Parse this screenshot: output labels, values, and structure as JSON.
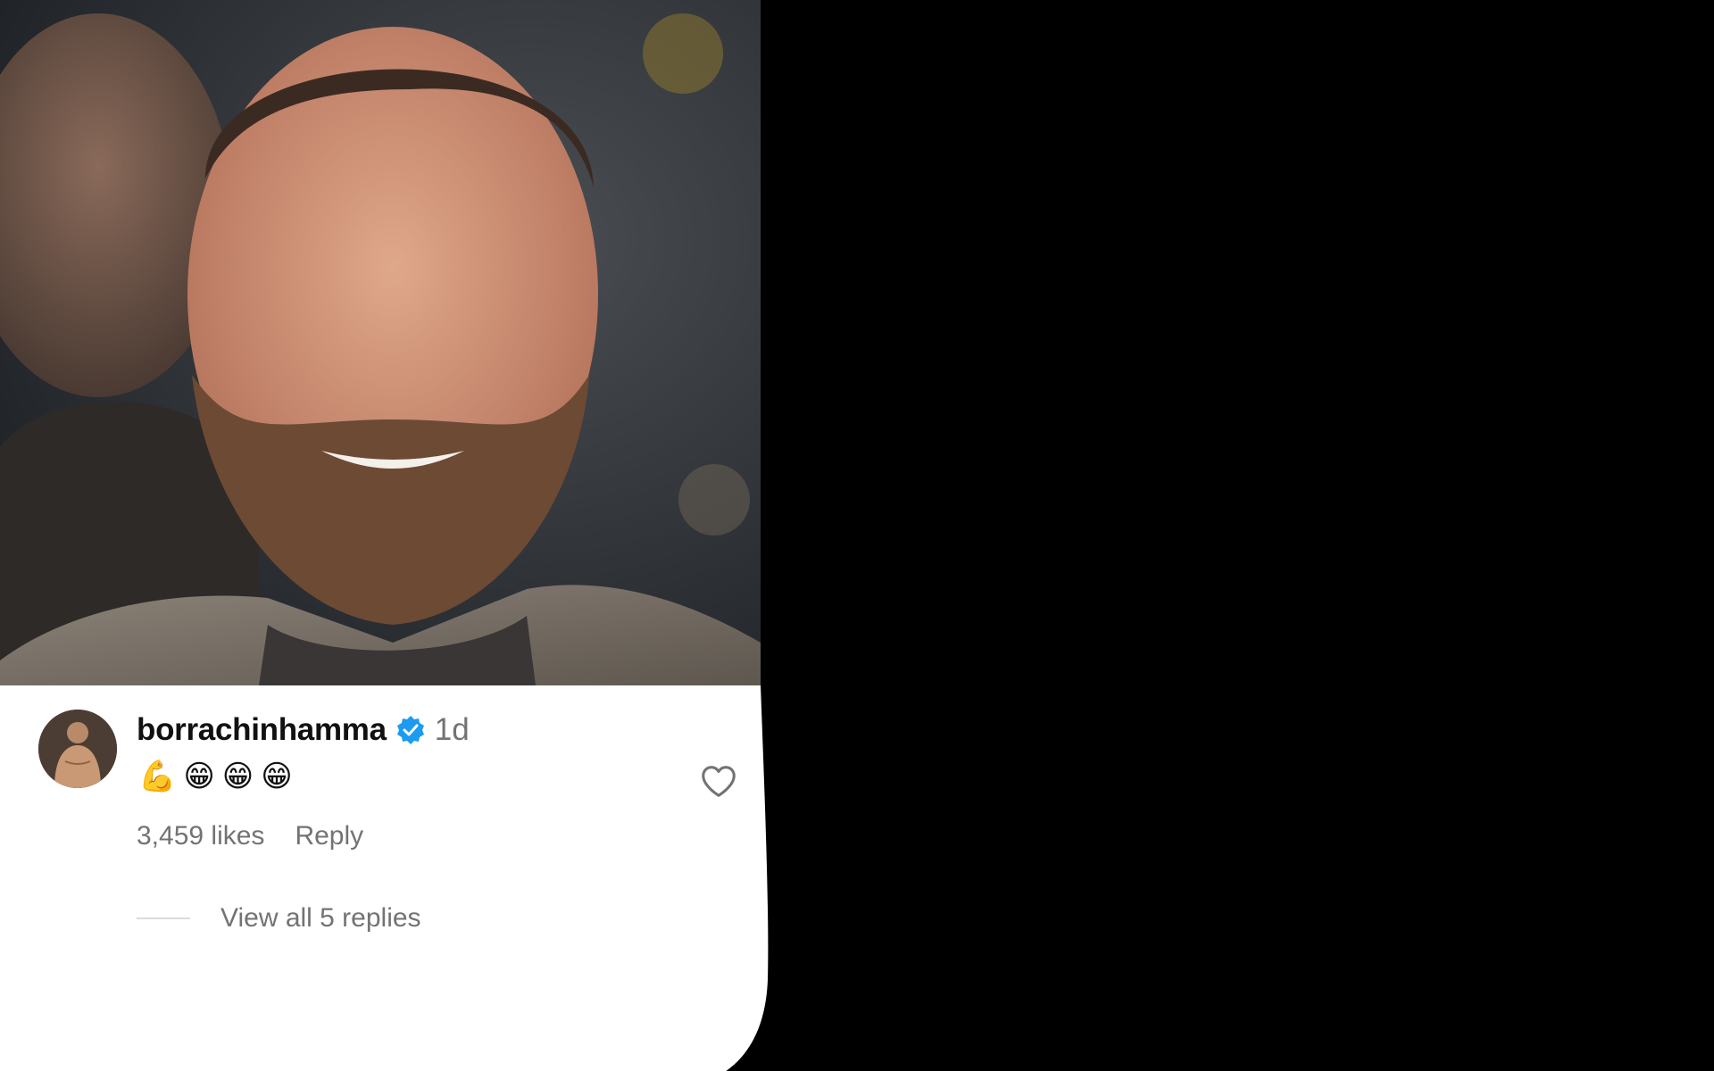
{
  "post": {
    "image_icon": "portrait-photo"
  },
  "comment": {
    "username": "borrachinhamma",
    "verified_icon": "verified-badge-icon",
    "timestamp": "1d",
    "text": "💪😁😁😁",
    "likes": "3,459 likes",
    "reply_label": "Reply",
    "view_replies": "View all 5 replies",
    "like_icon": "heart-outline-icon"
  },
  "colors": {
    "background": "#000000",
    "card": "#ffffff",
    "username": "#111111",
    "muted": "#737373",
    "verified": "#1d9bf0"
  }
}
